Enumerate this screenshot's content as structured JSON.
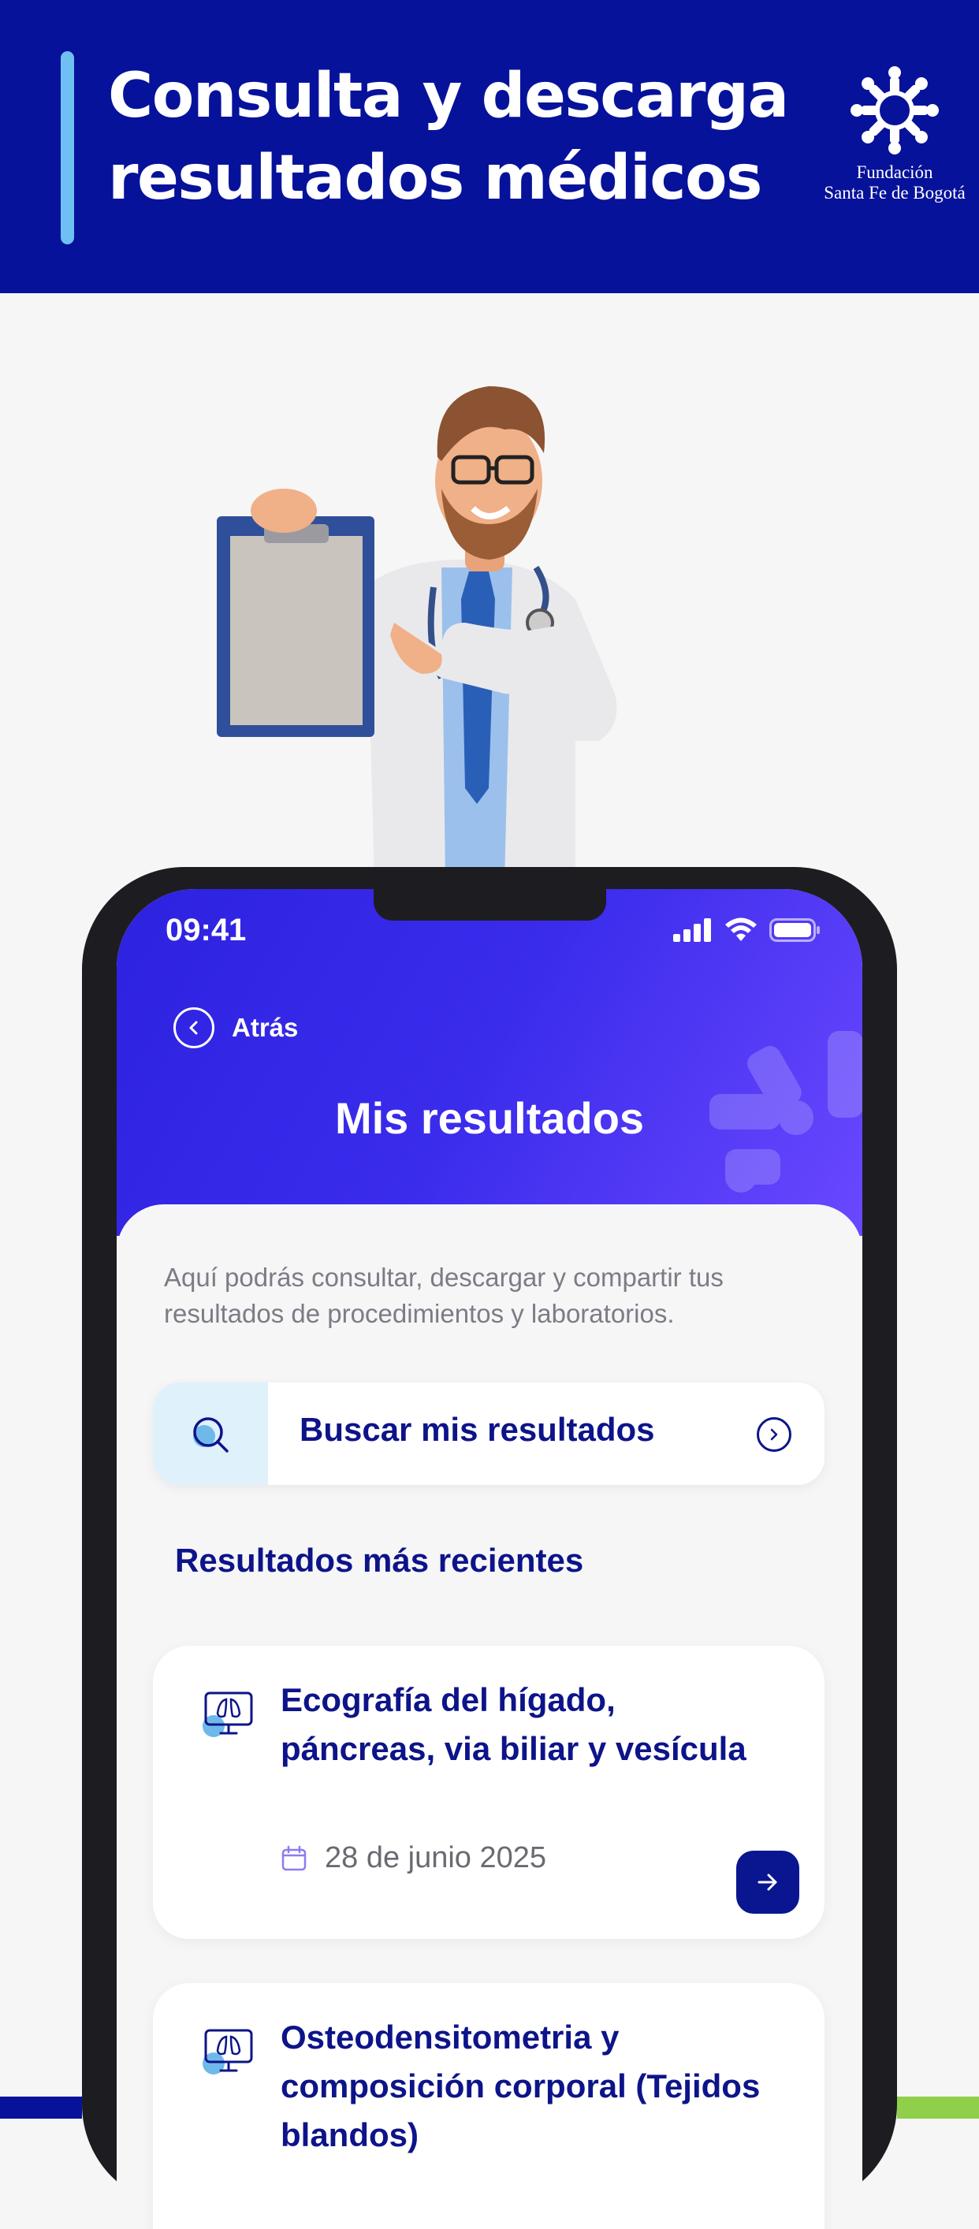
{
  "banner": {
    "title": "Consulta y descarga resultados médicos",
    "brand_line1": "Fundación",
    "brand_line2": "Santa Fe de Bogotá"
  },
  "phone": {
    "status_time": "09:41",
    "back_label": "Atrás",
    "screen_title": "Mis resultados",
    "intro_text": "Aquí podrás consultar, descargar y compartir tus resultados de procedimientos y laboratorios.",
    "search_label": "Buscar mis resultados",
    "section_title": "Resultados más recientes",
    "results": [
      {
        "title": "Ecografía del hígado, páncreas, via biliar y vesícula",
        "date": "28 de junio 2025"
      },
      {
        "title": "Osteodensitometria y composición corporal (Tejidos blandos)",
        "date": ""
      }
    ]
  },
  "colors": {
    "banner_bg": "#07129a",
    "accent_bar": "#6fc0f2",
    "primary_text": "#0d1489",
    "header_gradient_start": "#2d22e0",
    "header_gradient_end": "#6a48ff",
    "search_icon_bg": "#dff1fb",
    "bottom_green": "#8fcf4a"
  },
  "icons": {
    "brand": "foundation-logo-icon",
    "back": "chevron-left-icon",
    "search": "magnifier-icon",
    "chevron": "chevron-right-icon",
    "result": "monitor-lungs-icon",
    "calendar": "calendar-icon",
    "arrow": "arrow-right-icon",
    "signal": "signal-icon",
    "wifi": "wifi-icon",
    "battery": "battery-icon"
  }
}
